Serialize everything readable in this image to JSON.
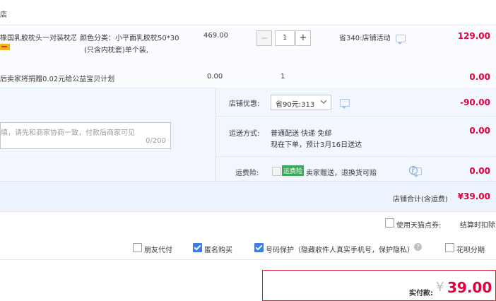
{
  "header": {
    "shop_text": "店"
  },
  "item": {
    "title": "橡国乳胶枕头一对装枕芯...",
    "spec_line1": "颜色分类：小平面乳胶枕50*30",
    "spec_line2": "(只含内枕套)单个装,",
    "price": "469.00",
    "quantity": "1",
    "minus_label": "−",
    "plus_label": "+",
    "promo": "省340:店铺活动",
    "subtotal": "129.00"
  },
  "charity": {
    "text": "后卖家将捐赠0.02元给公益宝贝计划",
    "price": "0.00",
    "quantity": "1",
    "subtotal": "0.00"
  },
  "store": {
    "discount_label": "店铺优惠:",
    "discount_select": "省90元:313",
    "discount_value": "-90.00",
    "shipping_label": "运送方式:",
    "shipping_method": "普通配送 快递 免邮",
    "shipping_eta": "现在下单，预计3月16日送达",
    "shipping_value": "0.00",
    "insurance_label": "运费险:",
    "insurance_badge": "运费险",
    "insurance_text": "卖家赠送，退换货可赔",
    "insurance_value": "0.00",
    "message_placeholder": "填，请先和商家协商一致，付款后商家可见",
    "message_counter": "0/200",
    "total_label": "店铺合计(含运费)",
    "total_value": "¥39.00"
  },
  "options": {
    "tmall_points_label": "使用天猫点券:",
    "settle_label": "结算时扣除",
    "friend_pay_label": "朋友代付",
    "anonymous_label": "匿名购买",
    "privacy_label": "号码保护（隐藏收件人真实手机号，保护隐私）",
    "huabei_label": "花呗分期"
  },
  "payment": {
    "label": "实付款:",
    "currency": "¥",
    "amount": "39.00"
  },
  "colors": {
    "price_red": "#e3003c",
    "accent_blue": "#3d7be5"
  }
}
